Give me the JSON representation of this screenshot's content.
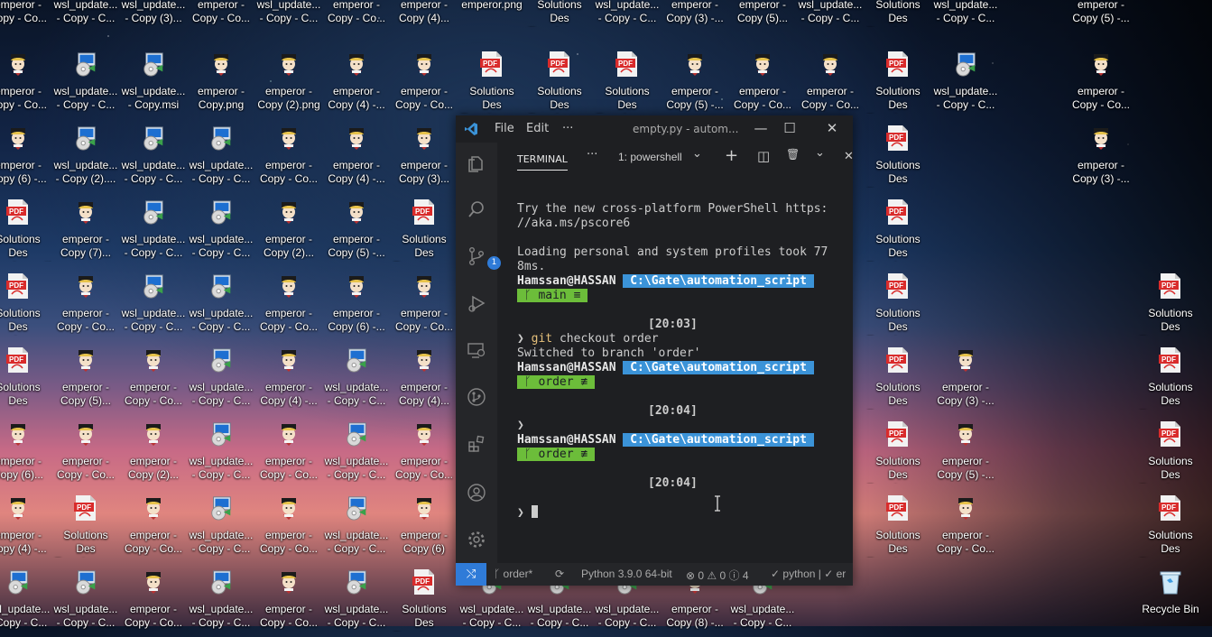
{
  "desktop": {
    "icons": [
      {
        "label": "emperor -\nCopy - Co...",
        "kind": "emperor"
      },
      {
        "label": "wsl_update...\n- Copy - C...",
        "kind": "msi"
      },
      {
        "label": "wsl_update...\n- Copy (3)...",
        "kind": "msi"
      },
      {
        "label": "emperor -\nCopy - Co...",
        "kind": "emperor"
      },
      {
        "label": "wsl_update...\n- Copy - C...",
        "kind": "msi"
      },
      {
        "label": "emperor -\nCopy - Co...",
        "kind": "emperor"
      },
      {
        "label": "emperor -\nCopy (4)...",
        "kind": "emperor"
      },
      {
        "label": "emperor.png",
        "kind": "emperor"
      },
      {
        "label": "Solutions Des\nExercices -...",
        "kind": "pdf"
      },
      {
        "label": "wsl_update...\n- Copy - C...",
        "kind": "msi"
      },
      {
        "label": "emperor -\nCopy (3) -...",
        "kind": "emperor"
      },
      {
        "label": "emperor -\nCopy (5)...",
        "kind": "emperor"
      },
      {
        "label": "wsl_update...\n- Copy - C...",
        "kind": "msi"
      },
      {
        "label": "Solutions Des\nExercices -...",
        "kind": "pdf"
      },
      {
        "label": "wsl_update...\n- Copy - C...",
        "kind": "msi"
      },
      {
        "label": "emperor -\nCopy (5) -...",
        "kind": "emperor"
      },
      {
        "label": "emperor -\nCopy - Co...",
        "kind": "emperor"
      },
      {
        "label": "wsl_update...\n- Copy - C...",
        "kind": "msi"
      },
      {
        "label": "wsl_update...\n- Copy.msi",
        "kind": "msi"
      },
      {
        "label": "emperor -\nCopy.png",
        "kind": "emperor"
      },
      {
        "label": "emperor -\nCopy (2).png",
        "kind": "emperor"
      },
      {
        "label": "emperor -\nCopy (4) -...",
        "kind": "emperor"
      },
      {
        "label": "emperor -\nCopy - Co...",
        "kind": "emperor"
      },
      {
        "label": "Solutions Des\nExercices -...",
        "kind": "pdf"
      },
      {
        "label": "Solutions Des\nExercices -...",
        "kind": "pdf"
      },
      {
        "label": "Solutions Des\nExercices -...",
        "kind": "pdf"
      },
      {
        "label": "emperor -\nCopy (5) -...",
        "kind": "emperor"
      },
      {
        "label": "emperor -\nCopy - Co...",
        "kind": "emperor"
      },
      {
        "label": "emperor -\nCopy - Co...",
        "kind": "emperor"
      },
      {
        "label": "Solutions Des\nExercices -...",
        "kind": "pdf"
      },
      {
        "label": "wsl_update...\n- Copy - C...",
        "kind": "msi"
      },
      {
        "label": "emperor -\nCopy - Co...",
        "kind": "emperor"
      },
      {
        "label": "emperor -\nCopy (6) -...",
        "kind": "emperor"
      },
      {
        "label": "wsl_update...\n- Copy (2)....",
        "kind": "msi"
      },
      {
        "label": "wsl_update...\n- Copy - C...",
        "kind": "msi"
      },
      {
        "label": "wsl_update...\n- Copy - C...",
        "kind": "msi"
      },
      {
        "label": "emperor -\nCopy - Co...",
        "kind": "emperor"
      },
      {
        "label": "emperor -\nCopy (4) -...",
        "kind": "emperor"
      },
      {
        "label": "emperor -\nCopy (3)...",
        "kind": "emperor"
      },
      {
        "label": "Solutions Des\nExercices -...",
        "kind": "pdf"
      },
      {
        "label": "emperor -\nCopy (3) -...",
        "kind": "emperor"
      },
      {
        "label": "Solutions Des\nExercices.pdf",
        "kind": "pdf"
      },
      {
        "label": "emperor -\nCopy (7)...",
        "kind": "emperor"
      },
      {
        "label": "wsl_update...\n- Copy - C...",
        "kind": "msi"
      },
      {
        "label": "wsl_update...\n- Copy - C...",
        "kind": "msi"
      },
      {
        "label": "emperor -\nCopy (2)...",
        "kind": "emperor"
      },
      {
        "label": "emperor -\nCopy (5) -...",
        "kind": "emperor"
      },
      {
        "label": "Solutions Des\nExercices -...",
        "kind": "pdf"
      },
      {
        "label": "Solutions Des\nExercices -...",
        "kind": "pdf"
      },
      {
        "label": "Solutions Des\nExercices -...",
        "kind": "pdf"
      },
      {
        "label": "emperor -\nCopy - Co...",
        "kind": "emperor"
      },
      {
        "label": "wsl_update...\n- Copy - C...",
        "kind": "msi"
      },
      {
        "label": "wsl_update...\n- Copy - C...",
        "kind": "msi"
      },
      {
        "label": "emperor -\nCopy - Co...",
        "kind": "emperor"
      },
      {
        "label": "emperor -\nCopy (6) -...",
        "kind": "emperor"
      },
      {
        "label": "emperor -\nCopy - Co...",
        "kind": "emperor"
      },
      {
        "label": "Solutions Des\nExercices -...",
        "kind": "pdf"
      },
      {
        "label": "Solutions Des\nExercices -...",
        "kind": "pdf"
      },
      {
        "label": "Solutions Des\nExercices -...",
        "kind": "pdf"
      },
      {
        "label": "emperor -\nCopy (5)...",
        "kind": "emperor"
      },
      {
        "label": "emperor -\nCopy - Co...",
        "kind": "emperor"
      },
      {
        "label": "wsl_update...\n- Copy - C...",
        "kind": "msi"
      },
      {
        "label": "emperor -\nCopy (4) -...",
        "kind": "emperor"
      },
      {
        "label": "wsl_update...\n- Copy - C...",
        "kind": "msi"
      },
      {
        "label": "emperor -\nCopy (4)...",
        "kind": "emperor"
      },
      {
        "label": "Solutions Des\nExercices -...",
        "kind": "pdf"
      },
      {
        "label": "emperor -\nCopy (3) -...",
        "kind": "emperor"
      },
      {
        "label": "Solutions Des\nExercices -...",
        "kind": "pdf"
      },
      {
        "label": "emperor -\nCopy (6)...",
        "kind": "emperor"
      },
      {
        "label": "emperor -\nCopy - Co...",
        "kind": "emperor"
      },
      {
        "label": "emperor -\nCopy (2)...",
        "kind": "emperor"
      },
      {
        "label": "wsl_update...\n- Copy - C...",
        "kind": "msi"
      },
      {
        "label": "emperor -\nCopy - Co...",
        "kind": "emperor"
      },
      {
        "label": "wsl_update...\n- Copy - C...",
        "kind": "msi"
      },
      {
        "label": "emperor -\nCopy - Co...",
        "kind": "emperor"
      },
      {
        "label": "Solutions Des\nExercices -...",
        "kind": "pdf"
      },
      {
        "label": "emperor -\nCopy (5) -...",
        "kind": "emperor"
      },
      {
        "label": "Solutions Des\nExercices -...",
        "kind": "pdf"
      },
      {
        "label": "emperor -\nCopy (4) -...",
        "kind": "emperor"
      },
      {
        "label": "Solutions Des\nExercices -...",
        "kind": "pdf"
      },
      {
        "label": "emperor -\nCopy - Co...",
        "kind": "emperor"
      },
      {
        "label": "wsl_update...\n- Copy - C...",
        "kind": "msi"
      },
      {
        "label": "emperor -\nCopy - Co...",
        "kind": "emperor"
      },
      {
        "label": "wsl_update...\n- Copy - C...",
        "kind": "msi"
      },
      {
        "label": "emperor -\nCopy (6)",
        "kind": "emperor"
      },
      {
        "label": "Solutions Des\nExercices -...",
        "kind": "pdf"
      },
      {
        "label": "emperor -\nCopy - Co...",
        "kind": "emperor"
      },
      {
        "label": "Solutions Des\nExercices -...",
        "kind": "pdf"
      },
      {
        "label": "wsl_update...\n- Copy - C...",
        "kind": "msi"
      },
      {
        "label": "wsl_update...\n- Copy - C...",
        "kind": "msi"
      },
      {
        "label": "emperor -\nCopy - Co...",
        "kind": "emperor"
      },
      {
        "label": "wsl_update...\n- Copy - C...",
        "kind": "msi"
      },
      {
        "label": "emperor -\nCopy - Co...",
        "kind": "emperor"
      },
      {
        "label": "wsl_update...\n- Copy - C...",
        "kind": "msi"
      },
      {
        "label": "Solutions Des\nExercices -...",
        "kind": "pdf"
      },
      {
        "label": "wsl_update...\n- Copy - C...",
        "kind": "msi"
      },
      {
        "label": "wsl_update...\n- Copy - C...",
        "kind": "msi"
      },
      {
        "label": "wsl_update...\n- Copy - C...",
        "kind": "msi"
      },
      {
        "label": "emperor -\nCopy (8) -...",
        "kind": "emperor"
      },
      {
        "label": "wsl_update...\n- Copy - C...",
        "kind": "msi"
      },
      {
        "label": "Recycle Bin",
        "kind": "bin"
      }
    ]
  },
  "vscode": {
    "menu": {
      "file": "File",
      "edit": "Edit",
      "more": "···"
    },
    "title": "empty.py - autom...",
    "window_controls": {
      "minimize": "—",
      "maximize": "☐",
      "close": "✕"
    },
    "scm_badge": "1",
    "panel": {
      "tab": "TERMINAL",
      "more": "···",
      "terminal_select": "1: powershell",
      "chevron": "⌄",
      "add": "+",
      "split": "◫",
      "trash": "🗑",
      "collapse": "⌄",
      "close": "✕"
    },
    "terminal": {
      "line1": "Try the new cross-platform PowerShell https:",
      "line2": "//aka.ms/pscore6",
      "line3": "Loading personal and system profiles took 77",
      "line4": "8ms.",
      "user": "Hamssan@HASSAN",
      "path": " C:\\Gate\\automation_script ",
      "branch_main": " ᚴ main ≡ ",
      "time1": "[20:03]",
      "prompt": "❯",
      "git_cmd": "git",
      "git_args": " checkout order",
      "switched": "Switched to branch 'order'",
      "branch_order": " ᚴ order ≢ ",
      "time2": "[20:04]",
      "time3": "[20:04]"
    },
    "status": {
      "remote": "⤭",
      "branch": "order*",
      "sync": "⟳",
      "python": "Python 3.9.0 64-bit",
      "problems": "⊗ 0 ⚠ 0 ⓘ 4",
      "lang": "✓ python | ✓ er"
    }
  }
}
